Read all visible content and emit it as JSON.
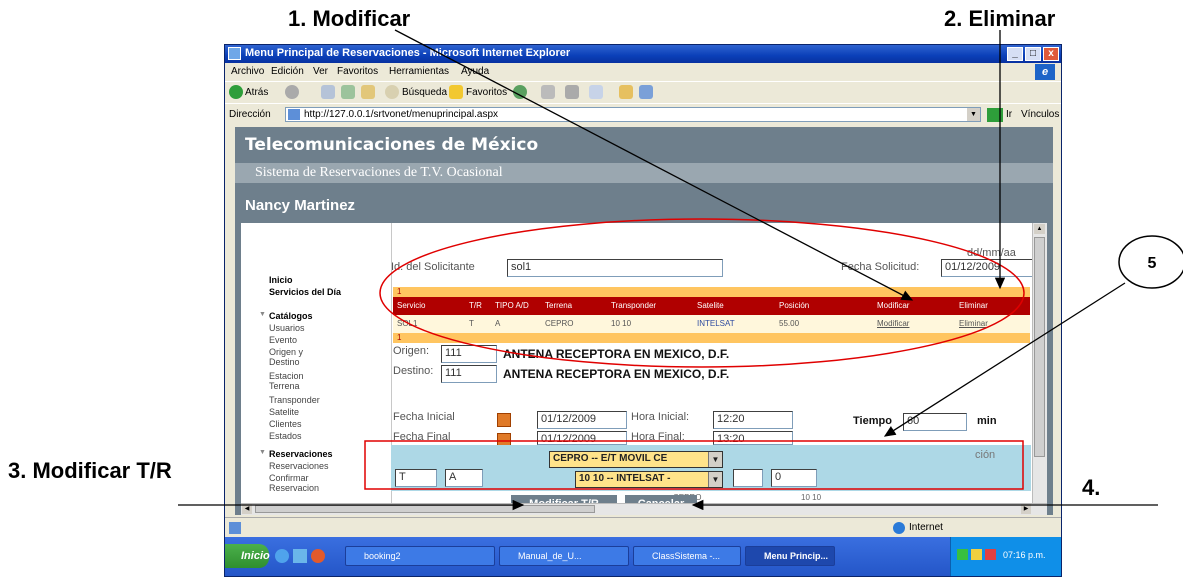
{
  "callouts": {
    "c1": "1. Modificar",
    "c2": "2. Eliminar",
    "c3": "3. Modificar T/R",
    "c4": "4.",
    "c5": "5"
  },
  "window": {
    "title": "Menu Principal de Reservaciones - Microsoft Internet Explorer",
    "controls": [
      "_",
      "Ɖ",
      "x"
    ]
  },
  "menu": [
    "Archivo",
    "Edición",
    "Ver",
    "Favoritos",
    "Herramientas",
    "Ayuda"
  ],
  "toolbar": {
    "back": "Atrás",
    "search": "Búsqueda",
    "favorites": "Favoritos"
  },
  "address": {
    "label": "Dirección",
    "url": "http://127.0.0.1/srtvonet/menuprincipal.aspx",
    "go": "Ir",
    "links": "Vínculos"
  },
  "header": {
    "company": "Telecomunicaciones de México",
    "system": "Sistema de Reservaciones de T.V. Ocasional",
    "user": "Nancy Martinez"
  },
  "sidebar": {
    "items": [
      {
        "label": "Inicio",
        "bold": true
      },
      {
        "label": "Servicios del Día",
        "bold": true
      },
      {
        "label": "Catálogos",
        "bold": true
      },
      {
        "label": "Usuarios",
        "bold": false
      },
      {
        "label": "Evento",
        "bold": false
      },
      {
        "label": "Origen y Destino",
        "bold": false
      },
      {
        "label": "Estacion Terrena",
        "bold": false
      },
      {
        "label": "Transponder",
        "bold": false
      },
      {
        "label": "Satelite",
        "bold": false
      },
      {
        "label": "Clientes",
        "bold": false
      },
      {
        "label": "Estados",
        "bold": false
      },
      {
        "label": "Reservaciones",
        "bold": true
      },
      {
        "label": "Reservaciones",
        "bold": false
      },
      {
        "label": "Confirmar Reservacion",
        "bold": false
      }
    ]
  },
  "form": {
    "solicitante_label": "Id. del Solicitante",
    "solicitante_value": "sol1",
    "fecha_solicitud_label": "Fecha Solicitud:",
    "fecha_solicitud_value": "01/12/2009",
    "date_hint": "dd/mm/aa",
    "origen_label": "Origen:",
    "origen_value": "111",
    "origen_desc": "ANTENA RECEPTORA EN MEXICO, D.F.",
    "destino_label": "Destino:",
    "destino_value": "111",
    "destino_desc": "ANTENA RECEPTORA EN MEXICO, D.F.",
    "fecha_inicial_label": "Fecha Inicial",
    "fecha_inicial_value": "01/12/2009",
    "hora_inicial_label": "Hora Inicial:",
    "hora_inicial_value": "12:20",
    "tiempo_label": "Tiempo",
    "tiempo_value": "60",
    "tiempo_unit": "min",
    "fecha_final_label": "Fecha Final",
    "fecha_final_value": "01/12/2009",
    "hora_final_label": "Hora Final:",
    "hora_final_value": "13:20",
    "posicion_partial": "ción",
    "tr_value": "T",
    "tipo_value": "A",
    "terrena_select": "CEPRO -- E/T MOVIL CE",
    "transponder_select": "10 10 -- INTELSAT -",
    "extra_value": "0",
    "behind_terrena": "CEPRO",
    "behind_transponder": "10 10",
    "modificar_button": "Modificar T/R",
    "cancelar_button": "Cancelar"
  },
  "grid": {
    "page_top": "1",
    "page_bottom": "1",
    "headers": [
      "Servicio",
      "T/R",
      "TIPO A/D",
      "Terrena",
      "Transponder",
      "Satelite",
      "Posición",
      "Modificar",
      "Eliminar"
    ],
    "row": [
      "SOL1",
      "T",
      "A",
      "CEPRO",
      "10 10",
      "INTELSAT",
      "55.00",
      "Modificar",
      "Eliminar"
    ]
  },
  "status": {
    "zone": "Internet"
  },
  "taskbar": {
    "start": "Inicio",
    "tasks": [
      "booking2",
      "Manual_de_U...",
      "ClassSistema -...",
      "Menu Princip..."
    ],
    "time": "07:16 p.m."
  },
  "colors": {
    "page_bg": "#6e7f8c",
    "grid_header": "#b00000",
    "grid_pager": "#ffc560",
    "grid_row": "#fff7dc",
    "panel": "#add8e6",
    "annotation_red": "#e00000"
  }
}
